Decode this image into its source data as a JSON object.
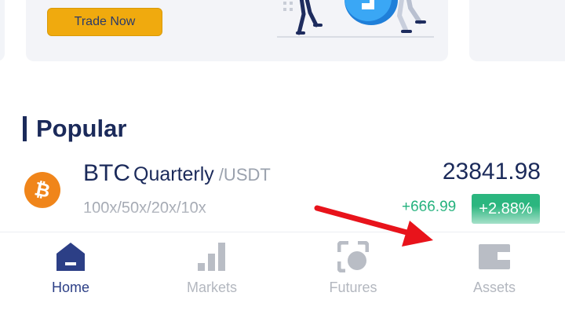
{
  "banner": {
    "trade_button_label": "Trade Now"
  },
  "popular": {
    "title": "Popular"
  },
  "market_item": {
    "symbol": "BTC",
    "contract_type": "Quarterly",
    "quote": "/USDT",
    "leverage": "100x/50x/20x/10x",
    "price": "23841.98",
    "change_abs": "+666.99",
    "change_pct": "+2.88%",
    "icon": "bitcoin-icon"
  },
  "nav": {
    "items": [
      {
        "label": "Home",
        "icon": "home-icon",
        "active": true
      },
      {
        "label": "Markets",
        "icon": "bar-chart-icon",
        "active": false
      },
      {
        "label": "Futures",
        "icon": "futures-icon",
        "active": false
      },
      {
        "label": "Assets",
        "icon": "wallet-icon",
        "active": false
      }
    ]
  },
  "colors": {
    "accent_navy": "#1b2a5a",
    "nav_active": "#2c3f86",
    "nav_inactive": "#b3b7bf",
    "positive": "#2bb67f",
    "button_yellow": "#f0aa0e",
    "annotation_red": "#e8131b"
  }
}
